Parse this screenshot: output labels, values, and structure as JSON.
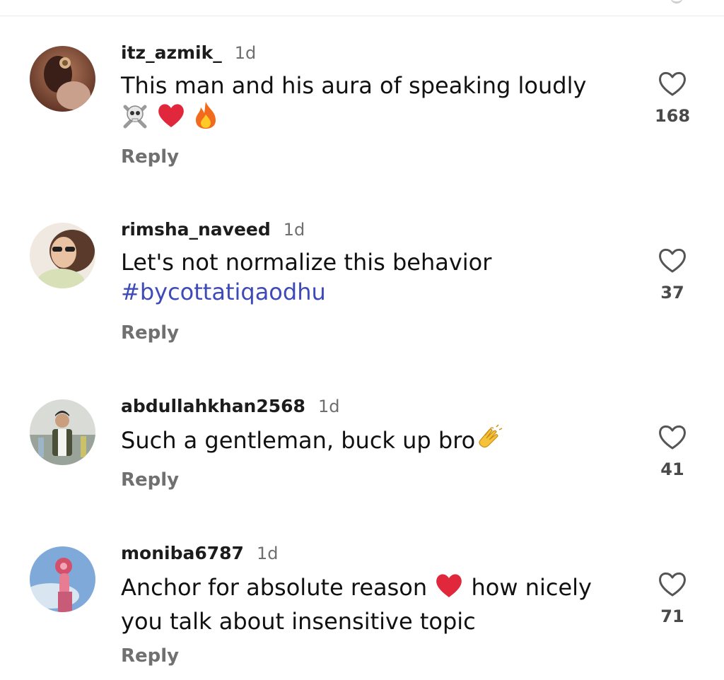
{
  "comments": [
    {
      "username": "itz_azmik_",
      "time": "1d",
      "text": "This man and his aura of speaking loudly",
      "emojis": [
        "skull-crossbones",
        "red-heart",
        "fire"
      ],
      "reply_label": "Reply",
      "likes": "168"
    },
    {
      "username": "rimsha_naveed",
      "time": "1d",
      "text": "Let's not normalize this behavior",
      "hashtag": "#bycottatiqaodhu",
      "reply_label": "Reply",
      "likes": "37"
    },
    {
      "username": "abdullahkhan2568",
      "time": "1d",
      "text": "Such a gentleman, buck up bro",
      "emojis": [
        "clapping-hands"
      ],
      "reply_label": "Reply",
      "likes": "41"
    },
    {
      "username": "moniba6787",
      "time": "1d",
      "text_part1": "Anchor for absolute reason",
      "text_part2": "how nicely you talk about insensitive topic",
      "emojis": [
        "red-heart"
      ],
      "reply_label": "Reply",
      "likes": "71"
    }
  ],
  "colors": {
    "hashtag": "#3d4ab7",
    "secondary_text": "#707070",
    "heart_red": "#e0273b"
  },
  "icons": {
    "like": "heart-outline-icon"
  }
}
